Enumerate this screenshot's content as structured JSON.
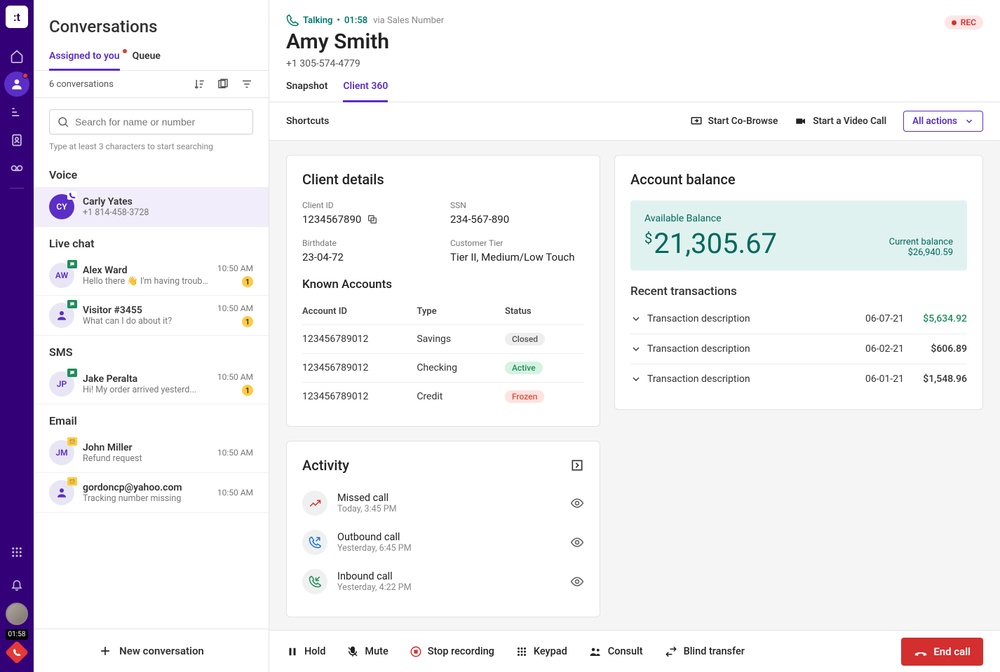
{
  "rail": {
    "timer": "01:58"
  },
  "conversations": {
    "title": "Conversations",
    "tabs": {
      "assigned": "Assigned to you",
      "queue": "Queue"
    },
    "count": "6 conversations",
    "search_placeholder": "Search for name or number",
    "search_hint": "Type at least 3 characters to start searching",
    "section_voice": "Voice",
    "section_livechat": "Live chat",
    "section_sms": "SMS",
    "section_email": "Email",
    "voice_item": {
      "initials": "CY",
      "name": "Carly Yates",
      "sub": "+1 814-458-3728"
    },
    "chat1": {
      "initials": "AW",
      "name": "Alex Ward",
      "sub": "Hello there 👋 I'm having trouble...",
      "time": "10:50 AM",
      "badge": "1"
    },
    "chat2": {
      "name": "Visitor #3455",
      "sub": "What can I do about it?",
      "time": "10:50 AM",
      "badge": "1"
    },
    "sms1": {
      "initials": "JP",
      "name": "Jake Peralta",
      "sub": "Hi! My order arrived yesterd...",
      "time": "10:50 AM",
      "badge": "1"
    },
    "email1": {
      "initials": "JM",
      "name": "John Miller",
      "sub": "Refund request",
      "time": "10:50 AM"
    },
    "email2": {
      "name": "gordoncp@yahoo.com",
      "sub": "Tracking number missing",
      "time": "10:50 AM"
    },
    "new_conversation": "New conversation"
  },
  "call": {
    "status_label": "Talking",
    "status_time": "01:58",
    "via": "via Sales Number",
    "rec": "REC",
    "name": "Amy Smith",
    "phone": "+1 305-574-4779",
    "tabs": {
      "snapshot": "Snapshot",
      "client360": "Client 360"
    }
  },
  "shortcuts": {
    "label": "Shortcuts",
    "cobrowse": "Start Co-Browse",
    "video": "Start a Video Call",
    "all_actions": "All actions"
  },
  "client_details": {
    "title": "Client details",
    "client_id_label": "Client ID",
    "client_id": "1234567890",
    "ssn_label": "SSN",
    "ssn": "234-567-890",
    "birth_label": "Birthdate",
    "birth": "23-04-72",
    "tier_label": "Customer Tier",
    "tier": "Tier II, Medium/Low Touch",
    "known_accounts": "Known Accounts",
    "col_account": "Account ID",
    "col_type": "Type",
    "col_status": "Status",
    "rows": [
      {
        "id": "123456789012",
        "type": "Savings",
        "status": "Closed",
        "class": "closed"
      },
      {
        "id": "123456789012",
        "type": "Checking",
        "status": "Active",
        "class": "active"
      },
      {
        "id": "123456789012",
        "type": "Credit",
        "status": "Frozen",
        "class": "frozen"
      }
    ]
  },
  "balance": {
    "title": "Account balance",
    "available_label": "Available Balance",
    "available": "21,305.67",
    "current_label": "Current balance",
    "current": "$26,940.59",
    "recent_title": "Recent transactions",
    "rows": [
      {
        "desc": "Transaction description",
        "date": "06-07-21",
        "amount": "$5,634.92",
        "pos": true
      },
      {
        "desc": "Transaction description",
        "date": "06-02-21",
        "amount": "$606.89",
        "pos": false
      },
      {
        "desc": "Transaction description",
        "date": "06-01-21",
        "amount": "$1,548.96",
        "pos": false
      }
    ]
  },
  "activity": {
    "title": "Activity",
    "rows": [
      {
        "title": "Missed call",
        "sub": "Today, 3:45 PM",
        "kind": "missed"
      },
      {
        "title": "Outbound call",
        "sub": "Yesterday, 6:45 PM",
        "kind": "out"
      },
      {
        "title": "Inbound call",
        "sub": "Yesterday, 4:22 PM",
        "kind": "in"
      }
    ]
  },
  "callbar": {
    "hold": "Hold",
    "mute": "Mute",
    "stoprec": "Stop recording",
    "keypad": "Keypad",
    "consult": "Consult",
    "blind": "Blind transfer",
    "end": "End call"
  }
}
